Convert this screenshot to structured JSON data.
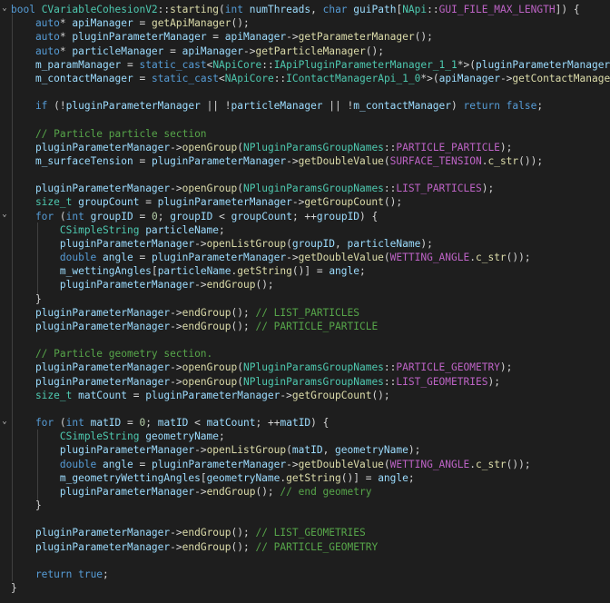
{
  "editor": {
    "colors": {
      "background": "#1e1e1e",
      "keyword": "#569cd6",
      "type": "#4ec9b0",
      "variable": "#9cdcfe",
      "function": "#dcdcaa",
      "comment": "#57a64a",
      "plain": "#d4d4d4",
      "macro": "#bd63c5",
      "number": "#b5cea8"
    },
    "fold_icons": [
      "chevron-down-icon",
      "chevron-down-icon",
      "chevron-down-icon"
    ],
    "lines": [
      [
        [
          "k",
          "bool "
        ],
        [
          "ty",
          "CVariableCohesionV2"
        ],
        [
          "pl",
          "::"
        ],
        [
          "fn",
          "starting"
        ],
        [
          "pl",
          "("
        ],
        [
          "k",
          "int "
        ],
        [
          "vr",
          "numThreads"
        ],
        [
          "pl",
          ", "
        ],
        [
          "k",
          "char "
        ],
        [
          "vr",
          "guiPath"
        ],
        [
          "pl",
          "["
        ],
        [
          "ty",
          "NApi"
        ],
        [
          "pl",
          "::"
        ],
        [
          "mac",
          "GUI_FILE_MAX_LENGTH"
        ],
        [
          "pl",
          "]) {"
        ]
      ],
      [
        [
          "k",
          "    auto"
        ],
        [
          "pl",
          "* "
        ],
        [
          "vr",
          "apiManager"
        ],
        [
          "pl",
          " = "
        ],
        [
          "fn",
          "getApiManager"
        ],
        [
          "pl",
          "();"
        ]
      ],
      [
        [
          "k",
          "    auto"
        ],
        [
          "pl",
          "* "
        ],
        [
          "vr",
          "pluginParameterManager"
        ],
        [
          "pl",
          " = "
        ],
        [
          "vr",
          "apiManager"
        ],
        [
          "pl",
          "->"
        ],
        [
          "fn",
          "getParameterManager"
        ],
        [
          "pl",
          "();"
        ]
      ],
      [
        [
          "k",
          "    auto"
        ],
        [
          "pl",
          "* "
        ],
        [
          "vr",
          "particleManager"
        ],
        [
          "pl",
          " = "
        ],
        [
          "vr",
          "apiManager"
        ],
        [
          "pl",
          "->"
        ],
        [
          "fn",
          "getParticleManager"
        ],
        [
          "pl",
          "();"
        ]
      ],
      [
        [
          "pl",
          "    "
        ],
        [
          "vr",
          "m_paramManager"
        ],
        [
          "pl",
          " = "
        ],
        [
          "k",
          "static_cast"
        ],
        [
          "pl",
          "<"
        ],
        [
          "ty",
          "NApiCore"
        ],
        [
          "pl",
          "::"
        ],
        [
          "ty",
          "IApiPluginParameterManager_1_1"
        ],
        [
          "pl",
          "*>("
        ],
        [
          "vr",
          "pluginParameterManager"
        ],
        [
          "pl",
          ");"
        ]
      ],
      [
        [
          "pl",
          "    "
        ],
        [
          "vr",
          "m_contactManager"
        ],
        [
          "pl",
          " = "
        ],
        [
          "k",
          "static_cast"
        ],
        [
          "pl",
          "<"
        ],
        [
          "ty",
          "NApiCore"
        ],
        [
          "pl",
          "::"
        ],
        [
          "ty",
          "IContactManagerApi_1_0"
        ],
        [
          "pl",
          "*>("
        ],
        [
          "vr",
          "apiManager"
        ],
        [
          "pl",
          "->"
        ],
        [
          "fn",
          "getContactManager"
        ],
        [
          "pl",
          "());"
        ]
      ],
      [
        [
          "pl",
          ""
        ]
      ],
      [
        [
          "k",
          "    if "
        ],
        [
          "pl",
          "(!"
        ],
        [
          "vr",
          "pluginParameterManager"
        ],
        [
          "pl",
          " || !"
        ],
        [
          "vr",
          "particleManager"
        ],
        [
          "pl",
          " || !"
        ],
        [
          "vr",
          "m_contactManager"
        ],
        [
          "pl",
          ") "
        ],
        [
          "k",
          "return "
        ],
        [
          "k",
          "false"
        ],
        [
          "pl",
          ";"
        ]
      ],
      [
        [
          "pl",
          ""
        ]
      ],
      [
        [
          "cm",
          "    // Particle particle section"
        ]
      ],
      [
        [
          "pl",
          "    "
        ],
        [
          "vr",
          "pluginParameterManager"
        ],
        [
          "pl",
          "->"
        ],
        [
          "fn",
          "openGroup"
        ],
        [
          "pl",
          "("
        ],
        [
          "ty",
          "NPluginParamsGroupNames"
        ],
        [
          "pl",
          "::"
        ],
        [
          "mac",
          "PARTICLE_PARTICLE"
        ],
        [
          "pl",
          ");"
        ]
      ],
      [
        [
          "pl",
          "    "
        ],
        [
          "vr",
          "m_surfaceTension"
        ],
        [
          "pl",
          " = "
        ],
        [
          "vr",
          "pluginParameterManager"
        ],
        [
          "pl",
          "->"
        ],
        [
          "fn",
          "getDoubleValue"
        ],
        [
          "pl",
          "("
        ],
        [
          "mac",
          "SURFACE_TENSION"
        ],
        [
          "pl",
          "."
        ],
        [
          "fn",
          "c_str"
        ],
        [
          "pl",
          "());"
        ]
      ],
      [
        [
          "pl",
          ""
        ]
      ],
      [
        [
          "pl",
          "    "
        ],
        [
          "vr",
          "pluginParameterManager"
        ],
        [
          "pl",
          "->"
        ],
        [
          "fn",
          "openGroup"
        ],
        [
          "pl",
          "("
        ],
        [
          "ty",
          "NPluginParamsGroupNames"
        ],
        [
          "pl",
          "::"
        ],
        [
          "mac",
          "LIST_PARTICLES"
        ],
        [
          "pl",
          ");"
        ]
      ],
      [
        [
          "ty",
          "    size_t "
        ],
        [
          "vr",
          "groupCount"
        ],
        [
          "pl",
          " = "
        ],
        [
          "vr",
          "pluginParameterManager"
        ],
        [
          "pl",
          "->"
        ],
        [
          "fn",
          "getGroupCount"
        ],
        [
          "pl",
          "();"
        ]
      ],
      [
        [
          "k",
          "    for "
        ],
        [
          "pl",
          "("
        ],
        [
          "k",
          "int "
        ],
        [
          "vr",
          "groupID"
        ],
        [
          "pl",
          " = "
        ],
        [
          "num",
          "0"
        ],
        [
          "pl",
          "; "
        ],
        [
          "vr",
          "groupID"
        ],
        [
          "pl",
          " < "
        ],
        [
          "vr",
          "groupCount"
        ],
        [
          "pl",
          "; ++"
        ],
        [
          "vr",
          "groupID"
        ],
        [
          "pl",
          ") {"
        ]
      ],
      [
        [
          "ty",
          "        CSimpleString "
        ],
        [
          "vr",
          "particleName"
        ],
        [
          "pl",
          ";"
        ]
      ],
      [
        [
          "pl",
          "        "
        ],
        [
          "vr",
          "pluginParameterManager"
        ],
        [
          "pl",
          "->"
        ],
        [
          "fn",
          "openListGroup"
        ],
        [
          "pl",
          "("
        ],
        [
          "vr",
          "groupID"
        ],
        [
          "pl",
          ", "
        ],
        [
          "vr",
          "particleName"
        ],
        [
          "pl",
          ");"
        ]
      ],
      [
        [
          "k",
          "        double "
        ],
        [
          "vr",
          "angle"
        ],
        [
          "pl",
          " = "
        ],
        [
          "vr",
          "pluginParameterManager"
        ],
        [
          "pl",
          "->"
        ],
        [
          "fn",
          "getDoubleValue"
        ],
        [
          "pl",
          "("
        ],
        [
          "mac",
          "WETTING_ANGLE"
        ],
        [
          "pl",
          "."
        ],
        [
          "fn",
          "c_str"
        ],
        [
          "pl",
          "());"
        ]
      ],
      [
        [
          "pl",
          "        "
        ],
        [
          "vr",
          "m_wettingAngles"
        ],
        [
          "pl",
          "["
        ],
        [
          "vr",
          "particleName"
        ],
        [
          "pl",
          "."
        ],
        [
          "fn",
          "getString"
        ],
        [
          "pl",
          "()] = "
        ],
        [
          "vr",
          "angle"
        ],
        [
          "pl",
          ";"
        ]
      ],
      [
        [
          "pl",
          "        "
        ],
        [
          "vr",
          "pluginParameterManager"
        ],
        [
          "pl",
          "->"
        ],
        [
          "fn",
          "endGroup"
        ],
        [
          "pl",
          "();"
        ]
      ],
      [
        [
          "pl",
          "    }"
        ]
      ],
      [
        [
          "pl",
          "    "
        ],
        [
          "vr",
          "pluginParameterManager"
        ],
        [
          "pl",
          "->"
        ],
        [
          "fn",
          "endGroup"
        ],
        [
          "pl",
          "(); "
        ],
        [
          "cm",
          "// LIST_PARTICLES"
        ]
      ],
      [
        [
          "pl",
          "    "
        ],
        [
          "vr",
          "pluginParameterManager"
        ],
        [
          "pl",
          "->"
        ],
        [
          "fn",
          "endGroup"
        ],
        [
          "pl",
          "(); "
        ],
        [
          "cm",
          "// PARTICLE_PARTICLE"
        ]
      ],
      [
        [
          "pl",
          ""
        ]
      ],
      [
        [
          "cm",
          "    // Particle geometry section."
        ]
      ],
      [
        [
          "pl",
          "    "
        ],
        [
          "vr",
          "pluginParameterManager"
        ],
        [
          "pl",
          "->"
        ],
        [
          "fn",
          "openGroup"
        ],
        [
          "pl",
          "("
        ],
        [
          "ty",
          "NPluginParamsGroupNames"
        ],
        [
          "pl",
          "::"
        ],
        [
          "mac",
          "PARTICLE_GEOMETRY"
        ],
        [
          "pl",
          ");"
        ]
      ],
      [
        [
          "pl",
          "    "
        ],
        [
          "vr",
          "pluginParameterManager"
        ],
        [
          "pl",
          "->"
        ],
        [
          "fn",
          "openGroup"
        ],
        [
          "pl",
          "("
        ],
        [
          "ty",
          "NPluginParamsGroupNames"
        ],
        [
          "pl",
          "::"
        ],
        [
          "mac",
          "LIST_GEOMETRIES"
        ],
        [
          "pl",
          ");"
        ]
      ],
      [
        [
          "ty",
          "    size_t "
        ],
        [
          "vr",
          "matCount"
        ],
        [
          "pl",
          " = "
        ],
        [
          "vr",
          "pluginParameterManager"
        ],
        [
          "pl",
          "->"
        ],
        [
          "fn",
          "getGroupCount"
        ],
        [
          "pl",
          "();"
        ]
      ],
      [
        [
          "pl",
          ""
        ]
      ],
      [
        [
          "k",
          "    for "
        ],
        [
          "pl",
          "("
        ],
        [
          "k",
          "int "
        ],
        [
          "vr",
          "matID"
        ],
        [
          "pl",
          " = "
        ],
        [
          "num",
          "0"
        ],
        [
          "pl",
          "; "
        ],
        [
          "vr",
          "matID"
        ],
        [
          "pl",
          " < "
        ],
        [
          "vr",
          "matCount"
        ],
        [
          "pl",
          "; ++"
        ],
        [
          "vr",
          "matID"
        ],
        [
          "pl",
          ") {"
        ]
      ],
      [
        [
          "ty",
          "        CSimpleString "
        ],
        [
          "vr",
          "geometryName"
        ],
        [
          "pl",
          ";"
        ]
      ],
      [
        [
          "pl",
          "        "
        ],
        [
          "vr",
          "pluginParameterManager"
        ],
        [
          "pl",
          "->"
        ],
        [
          "fn",
          "openListGroup"
        ],
        [
          "pl",
          "("
        ],
        [
          "vr",
          "matID"
        ],
        [
          "pl",
          ", "
        ],
        [
          "vr",
          "geometryName"
        ],
        [
          "pl",
          ");"
        ]
      ],
      [
        [
          "k",
          "        double "
        ],
        [
          "vr",
          "angle"
        ],
        [
          "pl",
          " = "
        ],
        [
          "vr",
          "pluginParameterManager"
        ],
        [
          "pl",
          "->"
        ],
        [
          "fn",
          "getDoubleValue"
        ],
        [
          "pl",
          "("
        ],
        [
          "mac",
          "WETTING_ANGLE"
        ],
        [
          "pl",
          "."
        ],
        [
          "fn",
          "c_str"
        ],
        [
          "pl",
          "());"
        ]
      ],
      [
        [
          "pl",
          "        "
        ],
        [
          "vr",
          "m_geometryWettingAngles"
        ],
        [
          "pl",
          "["
        ],
        [
          "vr",
          "geometryName"
        ],
        [
          "pl",
          "."
        ],
        [
          "fn",
          "getString"
        ],
        [
          "pl",
          "()] = "
        ],
        [
          "vr",
          "angle"
        ],
        [
          "pl",
          ";"
        ]
      ],
      [
        [
          "pl",
          "        "
        ],
        [
          "vr",
          "pluginParameterManager"
        ],
        [
          "pl",
          "->"
        ],
        [
          "fn",
          "endGroup"
        ],
        [
          "pl",
          "(); "
        ],
        [
          "cm",
          "// end geometry"
        ]
      ],
      [
        [
          "pl",
          "    }"
        ]
      ],
      [
        [
          "pl",
          ""
        ]
      ],
      [
        [
          "pl",
          "    "
        ],
        [
          "vr",
          "pluginParameterManager"
        ],
        [
          "pl",
          "->"
        ],
        [
          "fn",
          "endGroup"
        ],
        [
          "pl",
          "(); "
        ],
        [
          "cm",
          "// LIST_GEOMETRIES"
        ]
      ],
      [
        [
          "pl",
          "    "
        ],
        [
          "vr",
          "pluginParameterManager"
        ],
        [
          "pl",
          "->"
        ],
        [
          "fn",
          "endGroup"
        ],
        [
          "pl",
          "(); "
        ],
        [
          "cm",
          "// PARTICLE_GEOMETRY"
        ]
      ],
      [
        [
          "pl",
          ""
        ]
      ],
      [
        [
          "k",
          "    return "
        ],
        [
          "k",
          "true"
        ],
        [
          "pl",
          ";"
        ]
      ],
      [
        [
          "pl",
          "}"
        ]
      ]
    ]
  }
}
